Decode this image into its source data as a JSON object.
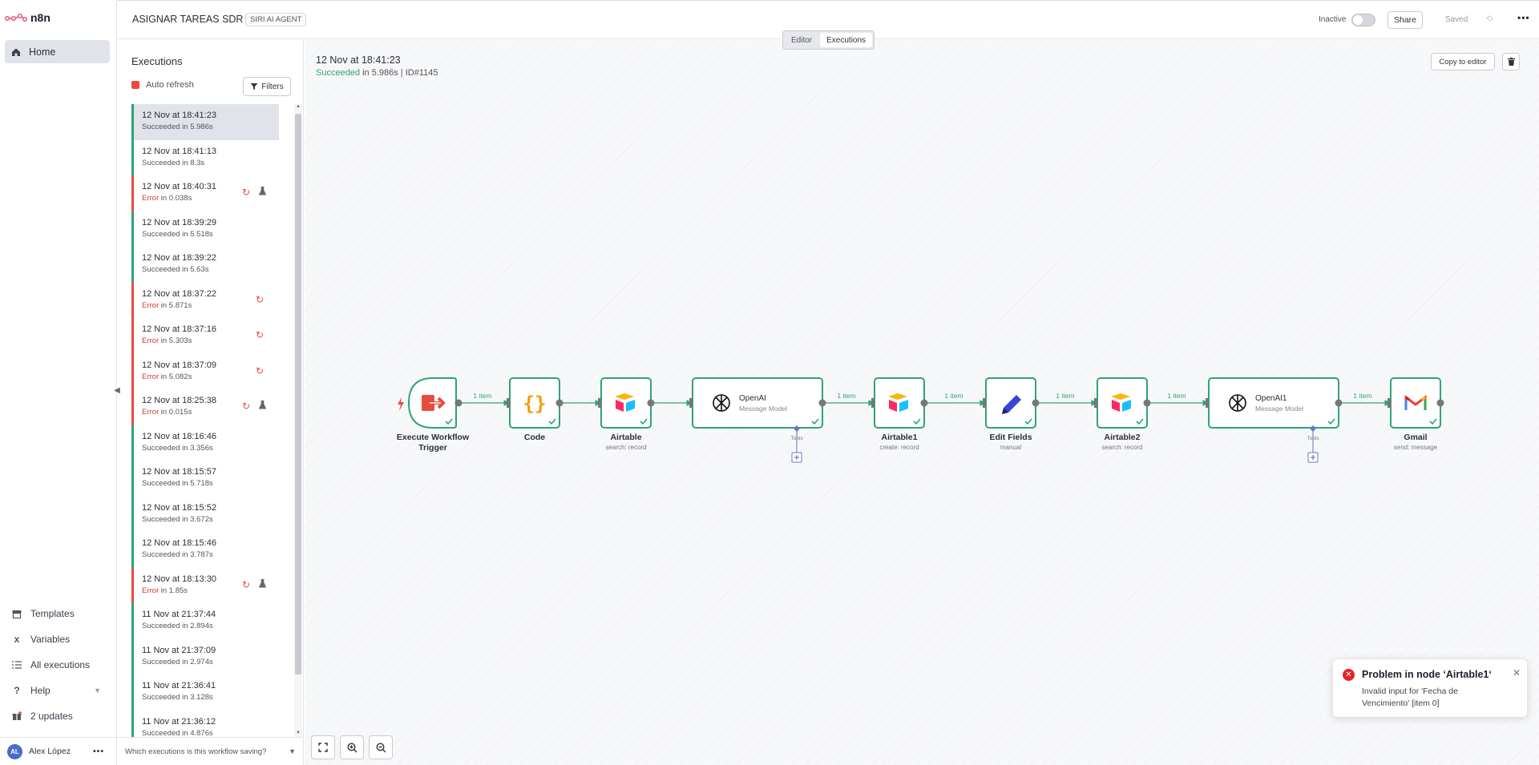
{
  "app": {
    "logo_text": "n8n"
  },
  "sidebar": {
    "home_label": "Home",
    "bottom_items": [
      {
        "label": "Templates",
        "icon": "box-icon"
      },
      {
        "label": "Variables",
        "icon": "variable-icon"
      },
      {
        "label": "All executions",
        "icon": "list-icon"
      },
      {
        "label": "Help",
        "icon": "question-icon"
      },
      {
        "label": "2 updates",
        "icon": "gift-icon"
      }
    ],
    "user": {
      "initials": "AL",
      "name": "Alex López"
    }
  },
  "header": {
    "workflow_title": "ASIGNAR TAREAS SDR",
    "tag": "SIRI AI AGENT",
    "inactive_label": "Inactive",
    "share_label": "Share",
    "saved_label": "Saved"
  },
  "tabs": {
    "editor": "Editor",
    "executions": "Executions"
  },
  "executions_panel": {
    "title": "Executions",
    "auto_refresh_label": "Auto refresh",
    "filters_label": "Filters",
    "which_label": "Which executions is this workflow saving?",
    "items": [
      {
        "date": "12 Nov at 18:41:23",
        "status": "Succeeded",
        "duration": " in 5.986s",
        "error": false,
        "retry": false,
        "flask": false,
        "selected": true
      },
      {
        "date": "12 Nov at 18:41:13",
        "status": "Succeeded",
        "duration": " in 8.3s",
        "error": false,
        "retry": false,
        "flask": false
      },
      {
        "date": "12 Nov at 18:40:31",
        "status": "Error",
        "duration": " in 0.038s",
        "error": true,
        "retry": true,
        "flask": true
      },
      {
        "date": "12 Nov at 18:39:29",
        "status": "Succeeded",
        "duration": " in 5.518s",
        "error": false,
        "retry": false,
        "flask": false
      },
      {
        "date": "12 Nov at 18:39:22",
        "status": "Succeeded",
        "duration": " in 5.63s",
        "error": false,
        "retry": false,
        "flask": false
      },
      {
        "date": "12 Nov at 18:37:22",
        "status": "Error",
        "duration": " in 5.871s",
        "error": true,
        "retry": true,
        "flask": false
      },
      {
        "date": "12 Nov at 18:37:16",
        "status": "Error",
        "duration": " in 5.303s",
        "error": true,
        "retry": true,
        "flask": false
      },
      {
        "date": "12 Nov at 18:37:09",
        "status": "Error",
        "duration": " in 5.082s",
        "error": true,
        "retry": true,
        "flask": false
      },
      {
        "date": "12 Nov at 18:25:38",
        "status": "Error",
        "duration": " in 0.015s",
        "error": true,
        "retry": true,
        "flask": true
      },
      {
        "date": "12 Nov at 18:16:46",
        "status": "Succeeded",
        "duration": " in 3.356s",
        "error": false,
        "retry": false,
        "flask": false
      },
      {
        "date": "12 Nov at 18:15:57",
        "status": "Succeeded",
        "duration": " in 5.718s",
        "error": false,
        "retry": false,
        "flask": false
      },
      {
        "date": "12 Nov at 18:15:52",
        "status": "Succeeded",
        "duration": " in 3.672s",
        "error": false,
        "retry": false,
        "flask": false
      },
      {
        "date": "12 Nov at 18:15:46",
        "status": "Succeeded",
        "duration": " in 3.787s",
        "error": false,
        "retry": false,
        "flask": false
      },
      {
        "date": "12 Nov at 18:13:30",
        "status": "Error",
        "duration": " in 1.85s",
        "error": true,
        "retry": true,
        "flask": true
      },
      {
        "date": "11 Nov at 21:37:44",
        "status": "Succeeded",
        "duration": " in 2.894s",
        "error": false,
        "retry": false,
        "flask": false
      },
      {
        "date": "11 Nov at 21:37:09",
        "status": "Succeeded",
        "duration": " in 2.974s",
        "error": false,
        "retry": false,
        "flask": false
      },
      {
        "date": "11 Nov at 21:36:41",
        "status": "Succeeded",
        "duration": " in 3.128s",
        "error": false,
        "retry": false,
        "flask": false
      },
      {
        "date": "11 Nov at 21:36:12",
        "status": "Succeeded",
        "duration": " in 4.876s",
        "error": false,
        "retry": false,
        "flask": false
      }
    ]
  },
  "execution_detail": {
    "date": "12 Nov at 18:41:23",
    "status": "Succeeded",
    "meta": " in 5.986s | ID#1145",
    "copy_label": "Copy to editor"
  },
  "workflow": {
    "nodes": [
      {
        "name": "Execute Workflow Trigger",
        "sub": ""
      },
      {
        "name": "Code",
        "sub": ""
      },
      {
        "name": "Airtable",
        "sub": "search: record"
      },
      {
        "name": "OpenAI",
        "sub": "Message Model"
      },
      {
        "name": "Airtable1",
        "sub": "create: record"
      },
      {
        "name": "Edit Fields",
        "sub": "manual"
      },
      {
        "name": "Airtable2",
        "sub": "search: record"
      },
      {
        "name": "OpenAI1",
        "sub": "Message Model"
      },
      {
        "name": "Gmail",
        "sub": "send: message"
      }
    ],
    "edge_labels": [
      "1 item",
      "1 item",
      "1 item",
      "1 item",
      "1 item",
      "1 item"
    ],
    "tools_label": "Tools",
    "success_color": "#2ea37a"
  },
  "toast": {
    "title": "Problem in node ‘Airtable1‘",
    "message": "Invalid input for 'Fecha de Vencimiento' [item 0]"
  }
}
